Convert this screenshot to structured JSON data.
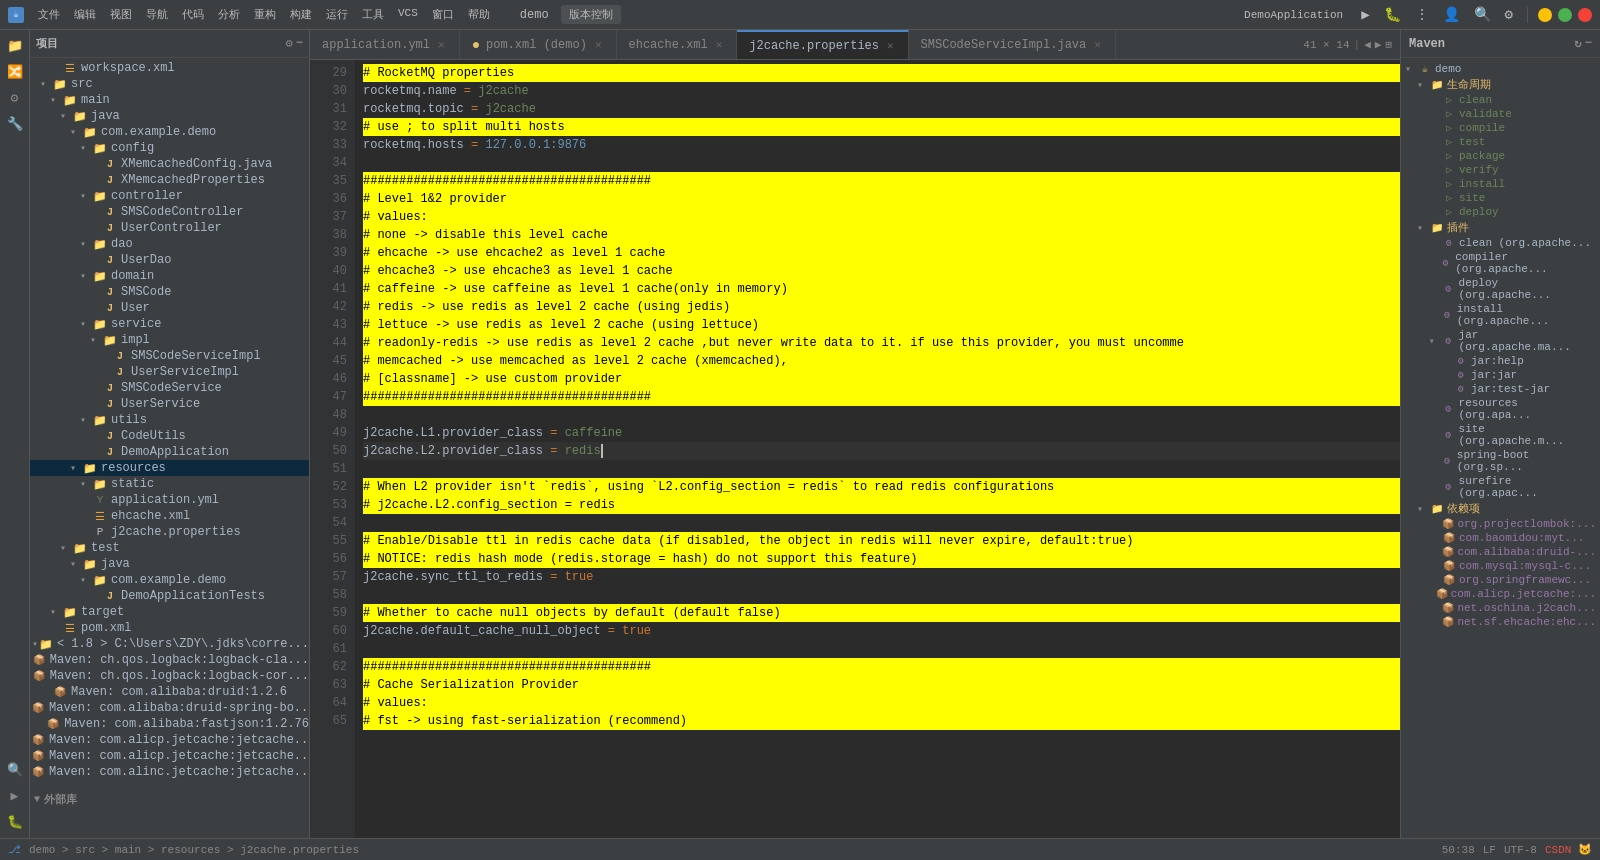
{
  "titlebar": {
    "app_icon": "☕",
    "app_name": "demo",
    "vcs_label": "版本控制",
    "menu_items": [
      "文件",
      "编辑",
      "视图",
      "导航",
      "代码",
      "分析",
      "重构",
      "构建",
      "运行",
      "工具",
      "VCS",
      "窗口",
      "帮助"
    ],
    "run_config": "DemoApplication",
    "search_icon": "🔍",
    "settings_icon": "⚙"
  },
  "sidebar": {
    "title": "项目",
    "tree": [
      {
        "id": "workspace",
        "label": "workspace.xml",
        "indent": 2,
        "type": "xml",
        "icon": "📄"
      },
      {
        "id": "src",
        "label": "src",
        "indent": 1,
        "type": "folder",
        "icon": "📁"
      },
      {
        "id": "main",
        "label": "main",
        "indent": 2,
        "type": "folder",
        "icon": "📁"
      },
      {
        "id": "java",
        "label": "java",
        "indent": 3,
        "type": "folder",
        "icon": "📁"
      },
      {
        "id": "com_example_demo",
        "label": "com.example.demo",
        "indent": 4,
        "type": "folder",
        "icon": "📁"
      },
      {
        "id": "config",
        "label": "config",
        "indent": 5,
        "type": "folder",
        "icon": "📁"
      },
      {
        "id": "xmemcachedconfig",
        "label": "XMemcachedConfig.java",
        "indent": 6,
        "type": "java",
        "icon": "J"
      },
      {
        "id": "xmemcachedprops",
        "label": "XMemcachedProperties",
        "indent": 6,
        "type": "java",
        "icon": "J"
      },
      {
        "id": "controller",
        "label": "controller",
        "indent": 5,
        "type": "folder",
        "icon": "📁"
      },
      {
        "id": "smscodecontroller",
        "label": "SMSCodeController",
        "indent": 6,
        "type": "java",
        "icon": "J"
      },
      {
        "id": "usercontroller",
        "label": "UserController",
        "indent": 6,
        "type": "java",
        "icon": "J"
      },
      {
        "id": "dao",
        "label": "dao",
        "indent": 5,
        "type": "folder",
        "icon": "📁"
      },
      {
        "id": "userdao",
        "label": "UserDao",
        "indent": 6,
        "type": "java",
        "icon": "J"
      },
      {
        "id": "domain",
        "label": "domain",
        "indent": 5,
        "type": "folder",
        "icon": "📁"
      },
      {
        "id": "smscode",
        "label": "SMSCode",
        "indent": 6,
        "type": "java",
        "icon": "J"
      },
      {
        "id": "user",
        "label": "User",
        "indent": 6,
        "type": "java",
        "icon": "J"
      },
      {
        "id": "service",
        "label": "service",
        "indent": 5,
        "type": "folder",
        "icon": "📁"
      },
      {
        "id": "impl",
        "label": "impl",
        "indent": 6,
        "type": "folder",
        "icon": "📁"
      },
      {
        "id": "smscodeserviceimpl",
        "label": "SMSCodeServiceImpl",
        "indent": 7,
        "type": "java",
        "icon": "J"
      },
      {
        "id": "userserviceimpl",
        "label": "UserServiceImpl",
        "indent": 7,
        "type": "java",
        "icon": "J"
      },
      {
        "id": "smscodeservice",
        "label": "SMSCodeService",
        "indent": 6,
        "type": "java",
        "icon": "J"
      },
      {
        "id": "userservice",
        "label": "UserService",
        "indent": 6,
        "type": "java",
        "icon": "J"
      },
      {
        "id": "utils",
        "label": "utils",
        "indent": 5,
        "type": "folder",
        "icon": "📁"
      },
      {
        "id": "codeutils",
        "label": "CodeUtils",
        "indent": 6,
        "type": "java",
        "icon": "J"
      },
      {
        "id": "demoapplication",
        "label": "DemoApplication",
        "indent": 6,
        "type": "java",
        "icon": "J"
      },
      {
        "id": "resources",
        "label": "resources",
        "indent": 4,
        "type": "folder",
        "icon": "📁",
        "selected": true
      },
      {
        "id": "static",
        "label": "static",
        "indent": 5,
        "type": "folder",
        "icon": "📁"
      },
      {
        "id": "applicationyml",
        "label": "application.yml",
        "indent": 5,
        "type": "yml",
        "icon": "Y"
      },
      {
        "id": "ehcachexml",
        "label": "ehcache.xml",
        "indent": 5,
        "type": "xml",
        "icon": "X"
      },
      {
        "id": "j2cacheprops",
        "label": "j2cache.properties",
        "indent": 5,
        "type": "prop",
        "icon": "P"
      },
      {
        "id": "test",
        "label": "test",
        "indent": 3,
        "type": "folder",
        "icon": "📁"
      },
      {
        "id": "testjava",
        "label": "java",
        "indent": 4,
        "type": "folder",
        "icon": "📁"
      },
      {
        "id": "testcomexample",
        "label": "com.example.demo",
        "indent": 5,
        "type": "folder",
        "icon": "📁"
      },
      {
        "id": "demoapptests",
        "label": "DemoApplicationTests",
        "indent": 6,
        "type": "java",
        "icon": "J"
      },
      {
        "id": "target",
        "label": "target",
        "indent": 2,
        "type": "folder",
        "icon": "📁"
      },
      {
        "id": "pomxml",
        "label": "pom.xml",
        "indent": 2,
        "type": "xml",
        "icon": "m"
      },
      {
        "id": "externaljdk",
        "label": "< 1.8 > C:\\Users\\ZDY\\.jdks\\corre...",
        "indent": 1,
        "type": "folder",
        "icon": "📁"
      },
      {
        "id": "ext1",
        "label": "Maven: ch.qos.logback:logback-cla...",
        "indent": 1,
        "type": "jar",
        "icon": "📦"
      },
      {
        "id": "ext2",
        "label": "Maven: ch.qos.logback:logback-cor...",
        "indent": 1,
        "type": "jar",
        "icon": "📦"
      },
      {
        "id": "ext3",
        "label": "Maven: com.alibaba:druid:1.2.6",
        "indent": 1,
        "type": "jar",
        "icon": "📦"
      },
      {
        "id": "ext4",
        "label": "Maven: com.alibaba:druid-spring-bo...",
        "indent": 1,
        "type": "jar",
        "icon": "📦"
      },
      {
        "id": "ext5",
        "label": "Maven: com.alibaba:fastjson:1.2.76",
        "indent": 1,
        "type": "jar",
        "icon": "📦"
      },
      {
        "id": "ext6",
        "label": "Maven: com.alicp.jetcache:jetcache...",
        "indent": 1,
        "type": "jar",
        "icon": "📦"
      },
      {
        "id": "ext7",
        "label": "Maven: com.alicp.jetcache:jetcache...",
        "indent": 1,
        "type": "jar",
        "icon": "📦"
      },
      {
        "id": "ext8",
        "label": "Maven: com.alinc.jetcache:jetcache...",
        "indent": 1,
        "type": "jar",
        "icon": "📦"
      }
    ]
  },
  "tabs": [
    {
      "id": "appyml",
      "label": "application.yml",
      "active": false,
      "modified": false,
      "closeable": true
    },
    {
      "id": "pomxml",
      "label": "pom.xml (demo)",
      "active": false,
      "modified": true,
      "closeable": true
    },
    {
      "id": "ehcachexml",
      "label": "ehcache.xml",
      "active": false,
      "modified": false,
      "closeable": true
    },
    {
      "id": "j2cacheprops",
      "label": "j2cache.properties",
      "active": true,
      "modified": false,
      "closeable": true
    },
    {
      "id": "smsserviceimpl",
      "label": "SMSCodeServiceImpl.java",
      "active": false,
      "modified": false,
      "closeable": true
    }
  ],
  "editor": {
    "file": "j2cache.properties",
    "line_count_label": "41 × 14",
    "lines": [
      {
        "num": 29,
        "content": "# RocketMQ properties",
        "type": "comment_yellow"
      },
      {
        "num": 30,
        "content": "rocketmq.name = j2cache",
        "type": "code"
      },
      {
        "num": 31,
        "content": "rocketmq.topic = j2cache",
        "type": "code"
      },
      {
        "num": 32,
        "content": "# use ; to split multi hosts",
        "type": "comment_yellow"
      },
      {
        "num": 33,
        "content": "rocketmq.hosts = 127.0.0.1:9876",
        "type": "code"
      },
      {
        "num": 34,
        "content": "",
        "type": "empty"
      },
      {
        "num": 35,
        "content": "########################################",
        "type": "comment_yellow"
      },
      {
        "num": 36,
        "content": "# Level 1&2 provider",
        "type": "comment_yellow"
      },
      {
        "num": 37,
        "content": "# values:",
        "type": "comment_yellow"
      },
      {
        "num": 38,
        "content": "# none -> disable this level cache",
        "type": "comment_yellow"
      },
      {
        "num": 39,
        "content": "# ehcache -> use ehcache2 as level 1 cache",
        "type": "comment_yellow"
      },
      {
        "num": 40,
        "content": "# ehcache3 -> use ehcache3 as level 1 cache",
        "type": "comment_yellow"
      },
      {
        "num": 41,
        "content": "# caffeine -> use caffeine as level 1 cache(only in memory)",
        "type": "comment_yellow"
      },
      {
        "num": 42,
        "content": "# redis -> use redis as level 2 cache (using jedis)",
        "type": "comment_yellow"
      },
      {
        "num": 43,
        "content": "# lettuce -> use redis as level 2 cache (using lettuce)",
        "type": "comment_yellow"
      },
      {
        "num": 44,
        "content": "# readonly-redis -> use redis as level 2 cache ,but never write data to it. if use this provider, you must uncomme",
        "type": "comment_yellow_long"
      },
      {
        "num": 45,
        "content": "# memcached -> use memcached as level 2 cache (xmemcached),",
        "type": "comment_yellow"
      },
      {
        "num": 46,
        "content": "# [classname] -> use custom provider",
        "type": "comment_yellow"
      },
      {
        "num": 47,
        "content": "########################################",
        "type": "comment_yellow"
      },
      {
        "num": 48,
        "content": "",
        "type": "empty"
      },
      {
        "num": 49,
        "content": "j2cache.L1.provider_class = caffeine",
        "type": "code"
      },
      {
        "num": 50,
        "content": "j2cache.L2.provider_class = redis",
        "type": "code_cursor"
      },
      {
        "num": 51,
        "content": "",
        "type": "empty"
      },
      {
        "num": 52,
        "content": "# When L2 provider isn't `redis`, using `L2.config_section = redis` to read redis configurations",
        "type": "comment_yellow"
      },
      {
        "num": 53,
        "content": "# j2cache.L2.config_section = redis",
        "type": "comment_yellow"
      },
      {
        "num": 54,
        "content": "",
        "type": "empty"
      },
      {
        "num": 55,
        "content": "# Enable/Disable ttl in redis cache data (if disabled, the object in redis will never expire, default:true)",
        "type": "comment_yellow"
      },
      {
        "num": 56,
        "content": "# NOTICE: redis hash mode (redis.storage = hash) do not support this feature)",
        "type": "comment_yellow"
      },
      {
        "num": 57,
        "content": "j2cache.sync_ttl_to_redis = true",
        "type": "code"
      },
      {
        "num": 58,
        "content": "",
        "type": "empty"
      },
      {
        "num": 59,
        "content": "# Whether to cache null objects by default (default false)",
        "type": "comment_yellow"
      },
      {
        "num": 60,
        "content": "j2cache.default_cache_null_object = true",
        "type": "code"
      },
      {
        "num": 61,
        "content": "",
        "type": "empty"
      },
      {
        "num": 62,
        "content": "########################################",
        "type": "comment_yellow"
      },
      {
        "num": 63,
        "content": "# Cache Serialization Provider",
        "type": "comment_yellow"
      },
      {
        "num": 64,
        "content": "# values:",
        "type": "comment_yellow"
      },
      {
        "num": 65,
        "content": "# fst -> using fast-serialization (recommend)",
        "type": "comment_yellow"
      }
    ]
  },
  "maven": {
    "title": "Maven",
    "sections": [
      {
        "label": "demo",
        "type": "root",
        "children": [
          {
            "label": "生命周期",
            "type": "section",
            "children": [
              {
                "label": "clean",
                "type": "lifecycle"
              },
              {
                "label": "validate",
                "type": "lifecycle"
              },
              {
                "label": "compile",
                "type": "lifecycle"
              },
              {
                "label": "test",
                "type": "lifecycle"
              },
              {
                "label": "package",
                "type": "lifecycle"
              },
              {
                "label": "verify",
                "type": "lifecycle"
              },
              {
                "label": "install",
                "type": "lifecycle"
              },
              {
                "label": "site",
                "type": "lifecycle"
              },
              {
                "label": "deploy",
                "type": "lifecycle"
              }
            ]
          },
          {
            "label": "插件",
            "type": "section",
            "children": [
              {
                "label": "clean (org.apache...",
                "type": "plugin"
              },
              {
                "label": "compiler (org.apache...",
                "type": "plugin"
              },
              {
                "label": "deploy (org.apache...",
                "type": "plugin"
              },
              {
                "label": "install (org.apache...",
                "type": "plugin"
              },
              {
                "label": "jar (org.apache.ma...",
                "type": "plugin",
                "children": [
                  {
                    "label": "jar:help",
                    "type": "plugin_goal"
                  },
                  {
                    "label": "jar:jar",
                    "type": "plugin_goal"
                  },
                  {
                    "label": "jar:test-jar",
                    "type": "plugin_goal"
                  }
                ]
              },
              {
                "label": "resources (org.apa...",
                "type": "plugin"
              },
              {
                "label": "site (org.apache.m...",
                "type": "plugin"
              },
              {
                "label": "spring-boot (org.sp...",
                "type": "plugin"
              },
              {
                "label": "surefire (org.apac...",
                "type": "plugin"
              }
            ]
          },
          {
            "label": "依赖项",
            "type": "section",
            "children": [
              {
                "label": "org.projectlombok:...",
                "type": "dep"
              },
              {
                "label": "com.baomidou:myt...",
                "type": "dep"
              },
              {
                "label": "com.alibaba:druid-...",
                "type": "dep"
              },
              {
                "label": "com.mysql:mysql-c...",
                "type": "dep"
              },
              {
                "label": "org.springframewc...",
                "type": "dep"
              },
              {
                "label": "com.alicp.jetcache:...",
                "type": "dep"
              },
              {
                "label": "net.oschina.j2cach...",
                "type": "dep"
              },
              {
                "label": "net.sf.ehcache:ehc...",
                "type": "dep"
              }
            ]
          }
        ]
      }
    ]
  },
  "statusbar": {
    "path": "demo > src > main > resources > j2cache.properties",
    "encoding": "UTF-8",
    "line_separator": "LF",
    "git_branch": "L",
    "line_col": "50:38"
  },
  "left_strip": {
    "buttons": [
      "📁",
      "🔀",
      "⚙",
      "🔧",
      "🔍",
      "▶",
      "🐛"
    ]
  }
}
